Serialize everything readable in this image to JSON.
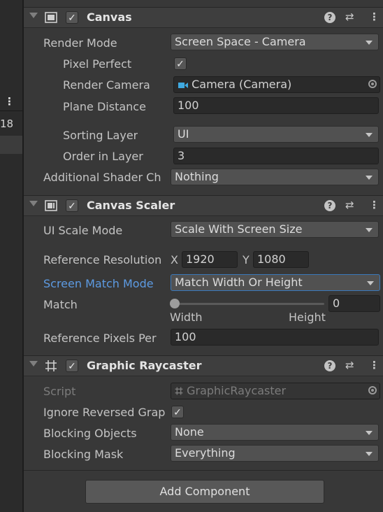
{
  "left_panel": {
    "more": "⋮",
    "number": "18"
  },
  "canvas": {
    "title": "Canvas",
    "enabled": "✓",
    "render_mode_label": "Render Mode",
    "render_mode_value": "Screen Space - Camera",
    "pixel_perfect_label": "Pixel Perfect",
    "pixel_perfect_value": "✓",
    "render_camera_label": "Render Camera",
    "render_camera_value": "Camera (Camera)",
    "plane_distance_label": "Plane Distance",
    "plane_distance_value": "100",
    "sorting_layer_label": "Sorting Layer",
    "sorting_layer_value": "UI",
    "order_in_layer_label": "Order in Layer",
    "order_in_layer_value": "3",
    "additional_shader_label": "Additional Shader Ch",
    "additional_shader_value": "Nothing"
  },
  "canvas_scaler": {
    "title": "Canvas Scaler",
    "enabled": "✓",
    "ui_scale_mode_label": "UI Scale Mode",
    "ui_scale_mode_value": "Scale With Screen Size",
    "reference_resolution_label": "Reference Resolution",
    "x_label": "X",
    "x_value": "1920",
    "y_label": "Y",
    "y_value": "1080",
    "screen_match_mode_label": "Screen Match Mode",
    "screen_match_mode_value": "Match Width Or Height",
    "match_label": "Match",
    "match_value": "0",
    "match_fraction": 0,
    "width_label": "Width",
    "height_label": "Height",
    "reference_pixels_label": "Reference Pixels Per",
    "reference_pixels_value": "100"
  },
  "graphic_raycaster": {
    "title": "Graphic Raycaster",
    "enabled": "✓",
    "script_label": "Script",
    "script_value": "GraphicRaycaster",
    "ignore_reversed_label": "Ignore Reversed Grap",
    "ignore_reversed_value": "✓",
    "blocking_objects_label": "Blocking Objects",
    "blocking_objects_value": "None",
    "blocking_mask_label": "Blocking Mask",
    "blocking_mask_value": "Everything"
  },
  "header_buttons": {
    "help": "?",
    "presets": "⇄",
    "menu": "⋮"
  },
  "add_component_label": "Add Component",
  "colors": {
    "background": "#383838",
    "field": "#2a2a2a",
    "dropdown": "#515151",
    "focus": "#3a79bb",
    "highlight_label": "#5d9be3"
  },
  "icons": [
    "canvas-icon",
    "canvas-scaler-icon",
    "graphic-raycaster-icon",
    "camera-icon",
    "target-icon",
    "script-icon"
  ]
}
